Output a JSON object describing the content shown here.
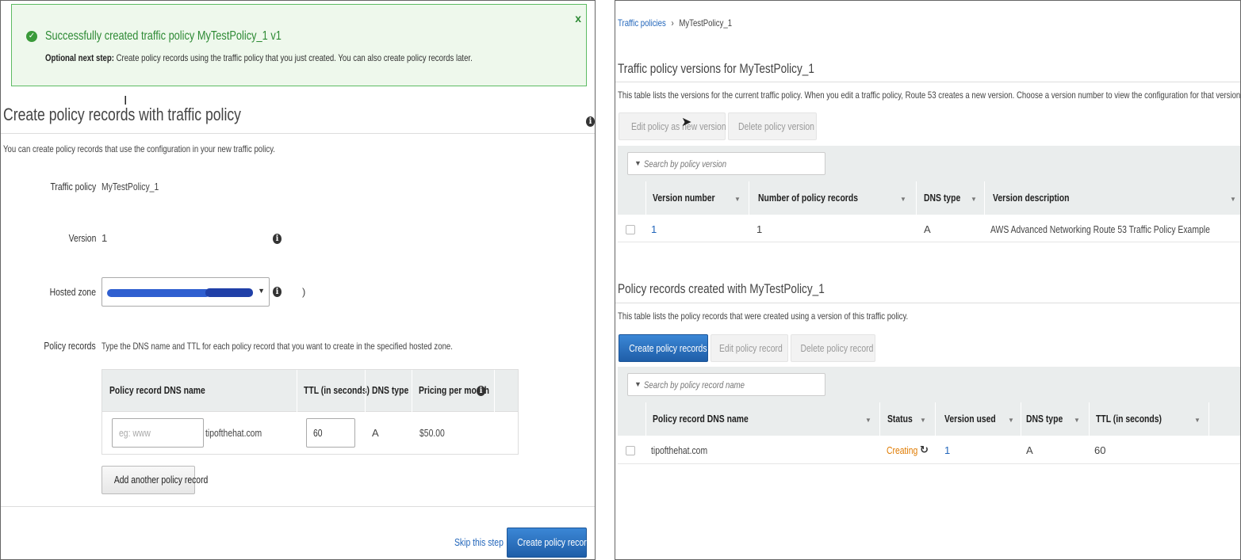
{
  "banner": {
    "title": "Successfully created traffic policy MyTestPolicy_1 v1",
    "optional_label": "Optional next step:",
    "optional_text": "Create policy records using the traffic policy that you just created. You can also create policy records later.",
    "close_glyph": "x"
  },
  "create_section": {
    "title": "Create policy records with traffic policy",
    "description": "You can create policy records that use the configuration in your new traffic policy.",
    "traffic_policy_label": "Traffic policy",
    "traffic_policy_value": "MyTestPolicy_1",
    "version_label": "Version",
    "version_value": "1",
    "hosted_zone_label": "Hosted zone",
    "hosted_zone_suffix": ")",
    "policy_records_label": "Policy records",
    "policy_records_help": "Type the DNS name and TTL for each policy record that you want to create in the specified hosted zone.",
    "table": {
      "col_dns_name": "Policy record DNS name",
      "col_ttl": "TTL (in seconds)",
      "col_dns_type": "DNS type",
      "col_pricing": "Pricing per month",
      "dns_placeholder": "eg: www",
      "dns_suffix": "tipofthehat.com",
      "ttl_value": "60",
      "dns_type_value": "A",
      "pricing_value": "$50.00"
    },
    "add_record_button": "Add another policy record",
    "skip_link": "Skip this step",
    "create_button": "Create policy records"
  },
  "right": {
    "breadcrumb_root": "Traffic policies",
    "breadcrumb_sep": "›",
    "breadcrumb_current": "MyTestPolicy_1",
    "versions_title": "Traffic policy versions for MyTestPolicy_1",
    "versions_desc": "This table lists the versions for the current traffic policy. When you edit a traffic policy, Route 53 creates a new version. Choose a version number to view the configuration for that version.",
    "edit_version_button": "Edit policy as new version",
    "delete_version_button": "Delete policy version",
    "versions_search_placeholder": "Search by policy version",
    "versions_table": {
      "headers": [
        "Version number",
        "Number of policy records",
        "DNS type",
        "Version description"
      ],
      "rows": [
        {
          "version": "1",
          "records": "1",
          "dns_type": "A",
          "description": "AWS Advanced Networking Route 53 Traffic Policy Example"
        }
      ]
    },
    "records_title": "Policy records created with MyTestPolicy_1",
    "records_desc": "This table lists the policy records that were created using a version of this traffic policy.",
    "create_records_button": "Create policy records",
    "edit_record_button": "Edit policy record",
    "delete_record_button": "Delete policy record",
    "records_search_placeholder": "Search by policy record name",
    "records_table": {
      "headers": [
        "Policy record DNS name",
        "Status",
        "Version used",
        "DNS type",
        "TTL (in seconds)"
      ],
      "rows": [
        {
          "dns_name": "tipofthehat.com",
          "status": "Creating",
          "version_used": "1",
          "dns_type": "A",
          "ttl": "60"
        }
      ]
    }
  },
  "colors": {
    "success_green": "#2d8a34",
    "link_blue": "#2266bb",
    "primary_blue": "#1f5ea8",
    "status_orange": "#e07b00"
  },
  "icons": {
    "success": "check-circle-icon",
    "info": "info-icon",
    "close": "close-icon",
    "filter": "filter-icon",
    "refresh": "refresh-icon",
    "sort": "sort-caret-icon"
  }
}
